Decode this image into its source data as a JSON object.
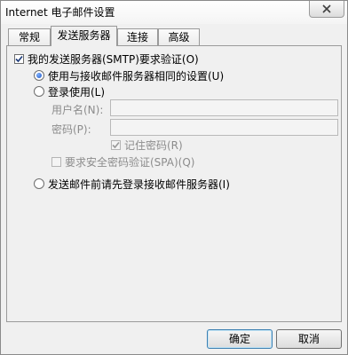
{
  "window": {
    "title": "Internet 电子邮件设置"
  },
  "tabs": [
    {
      "label": "常规",
      "active": false
    },
    {
      "label": "发送服务器",
      "active": true
    },
    {
      "label": "连接",
      "active": false
    },
    {
      "label": "高级",
      "active": false
    }
  ],
  "outgoing": {
    "auth_required_label": "我的发送服务器(SMTP)要求验证(O)",
    "auth_required_checked": true,
    "same_as_incoming_label": "使用与接收邮件服务器相同的设置(U)",
    "same_as_incoming_selected": true,
    "log_on_using_label": "登录使用(L)",
    "log_on_using_selected": false,
    "username_label": "用户名(N):",
    "username_value": "",
    "password_label": "密码(P):",
    "password_value": "",
    "remember_password_label": "记住密码(R)",
    "remember_password_checked": true,
    "spa_label": "要求安全密码验证(SPA)(Q)",
    "spa_checked": false,
    "log_on_incoming_first_label": "发送邮件前请先登录接收邮件服务器(I)",
    "log_on_incoming_first_selected": false
  },
  "buttons": {
    "ok_label": "确定",
    "cancel_label": "取消"
  },
  "colors": {
    "radio_selected": "#1f55c4",
    "disabled_text": "#8c8c8c",
    "default_button_border": "#3c7fb1"
  },
  "icons": {
    "close": "close-icon",
    "checkmark": "checkmark-icon"
  }
}
